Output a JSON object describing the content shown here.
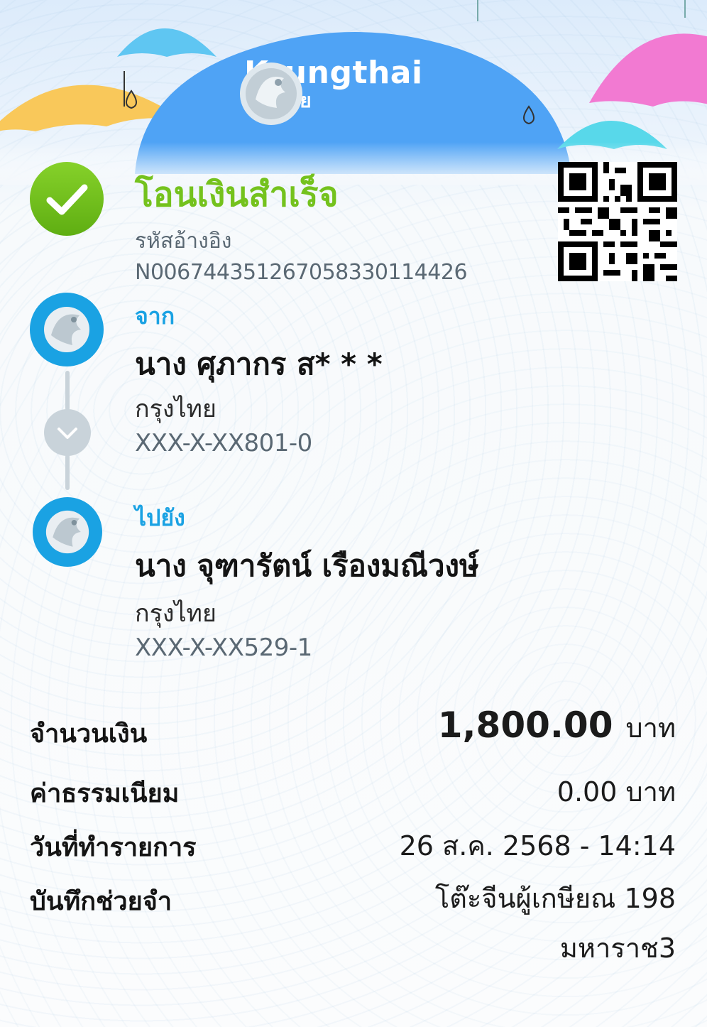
{
  "brand": {
    "name_en": "Krungthai",
    "name_th": "กรุงไทย"
  },
  "status": {
    "title": "โอนเงินสำเร็จ",
    "ref_label": "รหัสอ้างอิง",
    "ref_value": "N006744351267058330114426"
  },
  "from": {
    "label": "จาก",
    "name": "นาง ศุภากร ส* * *",
    "bank": "กรุงไทย",
    "account": "XXX-X-XX801-0"
  },
  "to": {
    "label": "ไปยัง",
    "name": "นาง จุฑารัตน์ เรืองมณีวงษ์",
    "bank": "กรุงไทย",
    "account": "XXX-X-XX529-1"
  },
  "details": {
    "amount_label": "จำนวนเงิน",
    "amount_value": "1,800.00",
    "amount_unit": "บาท",
    "fee_label": "ค่าธรรมเนียม",
    "fee_value": "0.00 บาท",
    "date_label": "วันที่ทำรายการ",
    "date_value": "26 ส.ค. 2568 - 14:14",
    "memo_label": "บันทึกช่วยจำ",
    "memo_line1": "โต๊ะจีนผู้เกษียณ 198",
    "memo_line2": "มหาราช3"
  },
  "colors": {
    "success": "#74c21d",
    "brand_blue": "#1aa2e3",
    "header_blue": "#4fa3f5"
  },
  "icons": {
    "status": "check-circle-icon",
    "party": "krungthai-logo-icon",
    "flow": "chevron-down-icon",
    "qr": "qr-code-icon"
  }
}
